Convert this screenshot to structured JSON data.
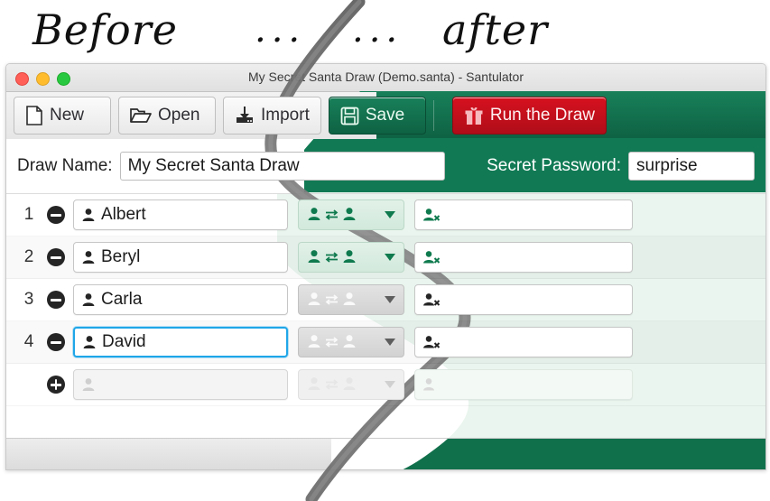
{
  "caption": {
    "before": "Before",
    "dots1": "...",
    "dots2": "...",
    "after": "after"
  },
  "window": {
    "title": "My Secret Santa Draw (Demo.santa) - Santulator",
    "traffic_lights": [
      "close-red",
      "minimize-yellow",
      "maximize-green"
    ]
  },
  "toolbar": {
    "buttons": [
      {
        "label": "New",
        "icon": "new-document-icon",
        "style": "light"
      },
      {
        "label": "Open",
        "icon": "open-folder-icon",
        "style": "light"
      },
      {
        "label": "Import",
        "icon": "import-icon",
        "style": "light"
      },
      {
        "label": "Save",
        "icon": "save-floppy-icon",
        "style": "green"
      },
      {
        "label": "Run the Draw",
        "icon": "gift-icon",
        "style": "red"
      }
    ]
  },
  "form": {
    "draw_name_label": "Draw Name:",
    "draw_name_value": "My Secret Santa Draw",
    "draw_name_placeholder": "Draw Name",
    "password_label": "Secret Password:",
    "password_value": "surprise",
    "password_placeholder": "Password"
  },
  "table": {
    "rows": [
      {
        "number": "1",
        "name": "Albert",
        "remove_icon": "minus-circle-icon",
        "person_icon": "person-icon",
        "exchange_icon": "person-exchange-icon",
        "exchange_state": "enabled-green",
        "exclusion_icon": "person-exclude-icon",
        "exclusion_state": "green",
        "exclusion_value": ""
      },
      {
        "number": "2",
        "name": "Beryl",
        "remove_icon": "minus-circle-icon",
        "person_icon": "person-icon",
        "exchange_icon": "person-exchange-icon",
        "exchange_state": "enabled-green",
        "exclusion_icon": "person-exclude-icon",
        "exclusion_state": "green",
        "exclusion_value": ""
      },
      {
        "number": "3",
        "name": "Carla",
        "remove_icon": "minus-circle-icon",
        "person_icon": "person-icon",
        "exchange_icon": "person-exchange-icon",
        "exchange_state": "disabled-grey",
        "exclusion_icon": "person-exclude-icon",
        "exclusion_state": "dark",
        "exclusion_value": ""
      },
      {
        "number": "4",
        "name": "David",
        "remove_icon": "minus-circle-icon",
        "person_icon": "person-icon",
        "exchange_icon": "person-exchange-icon",
        "exchange_state": "disabled-grey",
        "exclusion_icon": "person-exclude-icon",
        "exclusion_state": "dark",
        "exclusion_value": "",
        "focused": "true"
      },
      {
        "number": "",
        "name": "",
        "remove_icon": "plus-circle-icon",
        "person_icon": "person-icon-faded",
        "exchange_icon": "person-exchange-icon",
        "exchange_state": "faded",
        "exclusion_icon": "person-exclude-icon",
        "exclusion_state": "faded",
        "exclusion_value": ""
      }
    ]
  },
  "colors": {
    "brand_green": "#117a55",
    "toolbar_green_top": "#18805a",
    "toolbar_green_bottom": "#0e6243",
    "run_red": "#d6111f",
    "mint_row": "#e9f5ee",
    "focus_blue": "#1fa6e8",
    "status_green": "#11704c",
    "icon_green": "#0f7a4e",
    "icon_dark": "#252525",
    "light_button": "#f0f0f0"
  }
}
